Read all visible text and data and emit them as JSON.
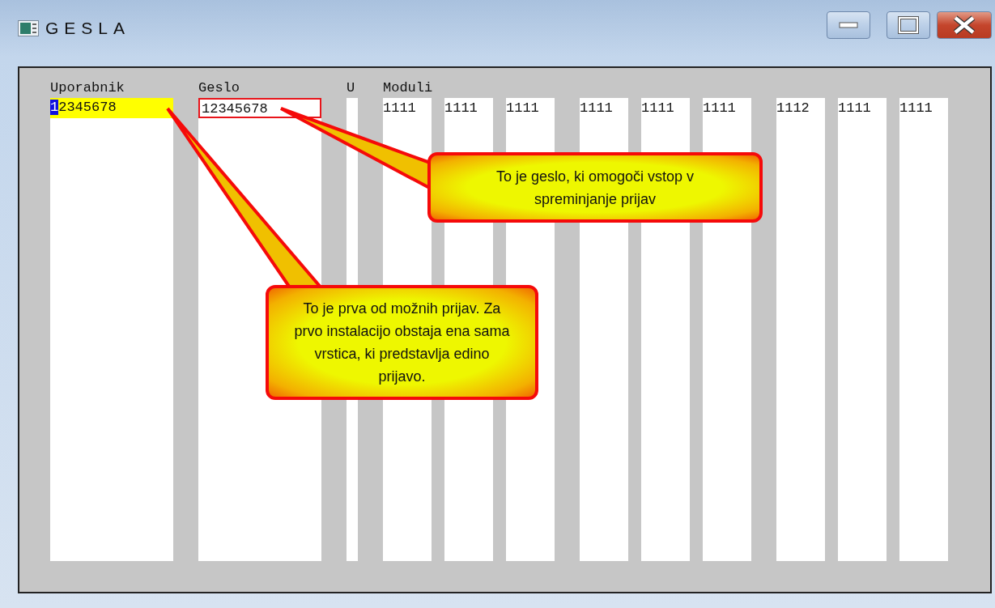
{
  "window": {
    "title": "GESLA"
  },
  "columns": [
    {
      "header": "Uporabnik",
      "kind": "wide",
      "value": "12345678",
      "selected": true,
      "highlighted": false,
      "cursor_at_start": true
    },
    {
      "header": "Geslo",
      "kind": "wide",
      "value": "12345678",
      "selected": false,
      "highlighted": true,
      "cursor_at_start": false
    },
    {
      "header": "U",
      "kind": "narrow"
    }
  ],
  "modules": {
    "header": "Moduli",
    "groups": [
      [
        "1111",
        "1111",
        "1111"
      ],
      [
        "1111",
        "1111",
        "1111"
      ],
      [
        "1112",
        "1111",
        "1111"
      ]
    ]
  },
  "callouts": [
    {
      "text": "To je geslo, ki omogoči vstop v spreminjanje prijav"
    },
    {
      "text": "To je prva od možnih prijav. Za prvo instalacijo obstaja ena sama vrstica, ki predstavlja edino prijavo."
    }
  ]
}
